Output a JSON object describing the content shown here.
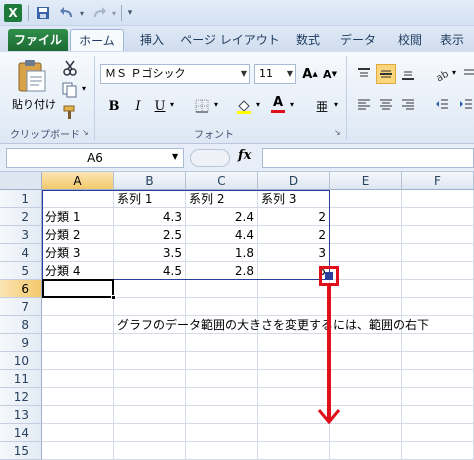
{
  "qat": {
    "logo": "X",
    "icons": [
      "save-icon",
      "undo-icon",
      "redo-icon",
      "customize-qat-icon"
    ]
  },
  "tabs": [
    "ファイル",
    "ホーム",
    "挿入",
    "ページ レイアウト",
    "数式",
    "データ",
    "校閲",
    "表示"
  ],
  "ribbon": {
    "paste_label": "貼り付け",
    "clipboard_label": "クリップボード",
    "font_name": "ＭＳ Ｐゴシック",
    "font_size": "11",
    "font_label": "フォント",
    "bold": "B",
    "italic": "I",
    "underline": "U",
    "grow_font": "A",
    "shrink_font": "A",
    "font_color_glyph": "A",
    "phonetic_glyph": "亜"
  },
  "formula_bar": {
    "name_box": "A6",
    "fx": "fx",
    "formula": ""
  },
  "sheet": {
    "columns": [
      "A",
      "B",
      "C",
      "D",
      "E",
      "F"
    ],
    "selected_column": "A",
    "rows": [
      "1",
      "2",
      "3",
      "4",
      "5",
      "6",
      "7",
      "8",
      "9",
      "10",
      "11",
      "12",
      "13",
      "14",
      "15"
    ],
    "selected_row": "6",
    "active_cell": "A6",
    "headers": [
      "系列 1",
      "系列 2",
      "系列 3"
    ],
    "data": [
      {
        "label": "分類 1",
        "values": [
          "4.3",
          "2.4",
          "2"
        ]
      },
      {
        "label": "分類 2",
        "values": [
          "2.5",
          "4.4",
          "2"
        ]
      },
      {
        "label": "分類 3",
        "values": [
          "3.5",
          "1.8",
          "3"
        ]
      },
      {
        "label": "分類 4",
        "values": [
          "4.5",
          "2.8",
          "5"
        ]
      }
    ],
    "note": "グラフのデータ範囲の大きさを変更するには、範囲の右下"
  },
  "colors": {
    "annotation_red": "#e0101a",
    "range_border": "#2a3f9c",
    "selected_header": "#f3c96c"
  }
}
